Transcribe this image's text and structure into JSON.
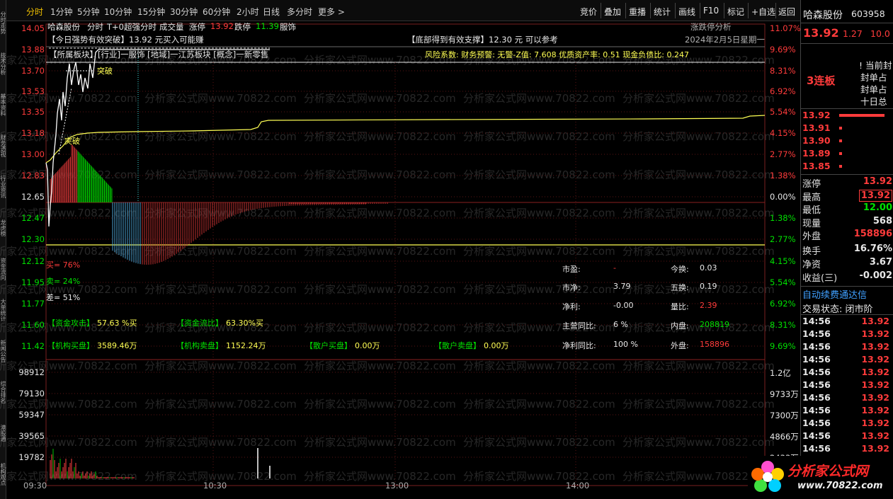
{
  "toolbar": {
    "left_tabs": [
      "分时",
      "1分钟",
      "5分钟",
      "10分钟",
      "15分钟",
      "30分钟",
      "60分钟",
      "2小时",
      "日线",
      "多分时",
      "更多 >"
    ],
    "active_tab": "分时",
    "right_buttons": [
      "竞价",
      "叠加",
      "重播",
      "统计",
      "画线",
      "F10",
      "标记",
      "+自选",
      "返回"
    ]
  },
  "vtabs": [
    "分时走势",
    "技术分析",
    "基本资料",
    "财务透视",
    "行业资讯",
    "龙虎榜",
    "资金流向",
    "大单统计",
    "新闻公告",
    "综合排名",
    "港股通",
    "机构观点"
  ],
  "header": {
    "stock_name": "哈森股份",
    "mode": "分时",
    "mode2": "T+0超强分时",
    "volume_label": "成交量",
    "limit_up_label": "涨停",
    "limit_up_value": "13.92",
    "limit_down_label": "跌停",
    "limit_down_value": "11.39",
    "fushi": "服饰",
    "analysis_link": "涨跌停分析"
  },
  "info_line1": {
    "left": "【今日强势有效突破】13.92 元买入可能赚",
    "mid": "【底部得到有效支撑】12.30 元 可以参考",
    "right": "2024年2月5日星期一"
  },
  "info_line2": {
    "left": "【所属板块】[行业]一服饰 [地域]一江苏板块 [概念]一新零售",
    "right": "风险系数: 财务预警: 无警-Z值: 7.608 优质资产率: 0.51 现金负债比: 0.247"
  },
  "chart_labels": {
    "breakout1": "突破",
    "breakout2": "突破"
  },
  "price_axis_left": [
    "14.05",
    "13.88",
    "13.70",
    "13.53",
    "13.35",
    "13.18",
    "13.00",
    "12.83",
    "12.65",
    "12.47",
    "12.30",
    "12.12",
    "11.95",
    "11.77",
    "11.60",
    "11.42"
  ],
  "pct_axis_right": [
    "11.07%",
    "9.69%",
    "8.31%",
    "6.92%",
    "5.54%",
    "4.15%",
    "2.77%",
    "1.38%",
    "0.00%",
    "1.38%",
    "2.77%",
    "4.15%",
    "5.54%",
    "6.92%",
    "8.31%",
    "9.69%"
  ],
  "vol_axis_left": [
    "98912",
    "79130",
    "59347",
    "39565",
    "19782"
  ],
  "vol_axis_right": [
    "1.2亿",
    "9733万",
    "7300万",
    "4866万",
    "2433万"
  ],
  "time_axis": [
    "09:30",
    "10:30",
    "13:00",
    "14:00"
  ],
  "stats_left": {
    "buy": "买= 76%",
    "sell": "卖= 24%",
    "diff": "差= 51%",
    "fund_attack_label": "【资金攻击】",
    "fund_attack_value": "57.63 %买",
    "fund_flow_label": "【资金流比】",
    "fund_flow_value": "63.30%买",
    "inst_buy_label": "【机构买盘】",
    "inst_buy_value": "3589.46万",
    "inst_sell_label": "【机构卖盘】",
    "inst_sell_value": "1152.24万",
    "retail_buy_label": "【散户买盘】",
    "retail_buy_value": "0.00万",
    "retail_sell_label": "【散户卖盘】",
    "retail_sell_value": "0.00万"
  },
  "stats_right": [
    {
      "k1": "市盈:",
      "v1": "-",
      "k2": "今换:",
      "v2": "0.03"
    },
    {
      "k1": "市净:",
      "v1": "3.79",
      "k2": "五换:",
      "v2": "0.19"
    },
    {
      "k1": "净利:",
      "v1": "-0.00",
      "k2": "量比:",
      "v2": "2.39"
    },
    {
      "k1": "主营同比:",
      "v1": "6 %",
      "k2": "内盘:",
      "v2": "208819"
    },
    {
      "k1": "净利同比:",
      "v1": "100 %",
      "k2": "外盘:",
      "v2": "158896"
    }
  ],
  "right_panel": {
    "name": "哈森股份",
    "code": "603958",
    "price": "13.92",
    "change": "1.27",
    "pct": "10.0",
    "streak": "3连板",
    "tags": [
      "当前封",
      "封单占",
      "封单占",
      "十日总"
    ],
    "order_book": [
      {
        "price": "13.92"
      },
      {
        "price": "13.91"
      },
      {
        "price": "13.90"
      },
      {
        "price": "13.89"
      },
      {
        "price": "13.85"
      }
    ],
    "quote": [
      {
        "k": "涨停",
        "v": "13.92"
      },
      {
        "k": "最高",
        "v": "13.92"
      },
      {
        "k": "最低",
        "v": "12.00"
      },
      {
        "k": "现量",
        "v": "568"
      },
      {
        "k": "外盘",
        "v": "158896"
      },
      {
        "k": "换手",
        "v": "16.76%"
      },
      {
        "k": "净资",
        "v": "3.67"
      },
      {
        "k": "收益(三)",
        "v": "-0.002"
      }
    ],
    "marquee": "自动续费通达信",
    "trade_status": "交易状态: 闭市阶",
    "ticks": [
      {
        "t": "14:56",
        "p": "13.92"
      },
      {
        "t": "14:56",
        "p": "13.92"
      },
      {
        "t": "14:56",
        "p": "13.92"
      },
      {
        "t": "14:56",
        "p": "13.92"
      },
      {
        "t": "14:56",
        "p": "13.92"
      },
      {
        "t": "14:56",
        "p": "13.92"
      },
      {
        "t": "14:56",
        "p": "13.92"
      },
      {
        "t": "14:56",
        "p": "13.92"
      },
      {
        "t": "14:56",
        "p": "13.92"
      },
      {
        "t": "14:56",
        "p": "13.92"
      },
      {
        "t": "14:56",
        "p": "13.92"
      }
    ]
  },
  "watermark": "分析家公式网www.70822.com",
  "logo": {
    "text": "分析家公式网",
    "url": "www.70822.com"
  },
  "colors": {
    "up": "#ff3b3b",
    "down": "#00e000",
    "avg_line": "#ffff54",
    "price_line": "#ffffff",
    "bg": "#000000"
  }
}
